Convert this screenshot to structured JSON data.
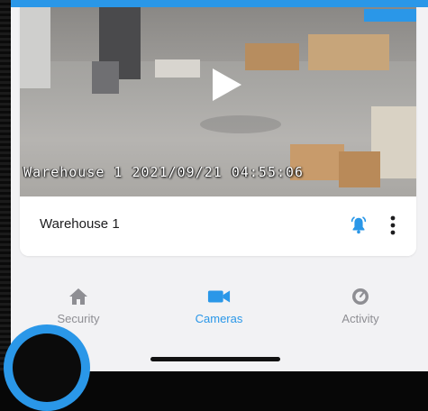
{
  "camera": {
    "name": "Warehouse 1",
    "overlay_text": "Warehouse 1 2021/09/21 04:55:06",
    "video_state": "paused"
  },
  "tabs": [
    {
      "label": "Security",
      "icon": "home-icon",
      "active": false
    },
    {
      "label": "Cameras",
      "icon": "video-camera-icon",
      "active": true
    },
    {
      "label": "Activity",
      "icon": "activity-icon",
      "active": false
    }
  ],
  "colors": {
    "accent": "#2a97e8",
    "inactive": "#8e8e93",
    "background": "#f2f2f4",
    "card": "#ffffff"
  }
}
